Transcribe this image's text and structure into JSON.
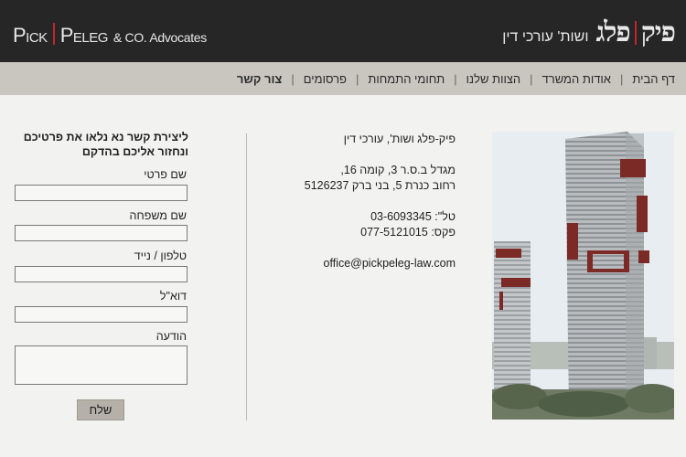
{
  "header": {
    "logo_en_name1": "Pick",
    "logo_en_name2": "Peleg",
    "logo_en_suffix": "& CO. Advocates",
    "logo_he_name1": "פיק",
    "logo_he_name2": "פלג",
    "logo_he_tagline": "ושות' עורכי דין",
    "accent_color": "#c0272d"
  },
  "nav": {
    "items": [
      {
        "label": "דף הבית"
      },
      {
        "label": "אודות המשרד"
      },
      {
        "label": "הצוות שלנו"
      },
      {
        "label": "תחומי התמחות"
      },
      {
        "label": "פרסומים"
      },
      {
        "label": "צור קשר",
        "active": true
      }
    ]
  },
  "contact": {
    "firm_name": "פיק-פלג ושות', עורכי דין",
    "address_line1": "מגדל ב.ס.ר 3, קומה 16,",
    "address_line2": "רחוב כנרת 5, בני ברק 5126237",
    "phone_label": "טל\":",
    "phone": "03-6093345",
    "fax_label": "פקס:",
    "fax": "077-5121015",
    "email": "office@pickpeleg-law.com"
  },
  "form": {
    "intro_line1": "ליצירת קשר נא נלאו את פרטיכם",
    "intro_line2": "ונחזור אליכם בהדקם",
    "first_name_label": "שם פרטי",
    "first_name_value": "",
    "last_name_label": "שם משפחה",
    "last_name_value": "",
    "phone_label": "טלפון / נייד",
    "phone_value": "",
    "email_label": "דוא\"ל",
    "email_value": "",
    "message_label": "הודעה",
    "message_value": "",
    "submit_label": "שלח"
  },
  "image": {
    "icon": "building-photo"
  }
}
